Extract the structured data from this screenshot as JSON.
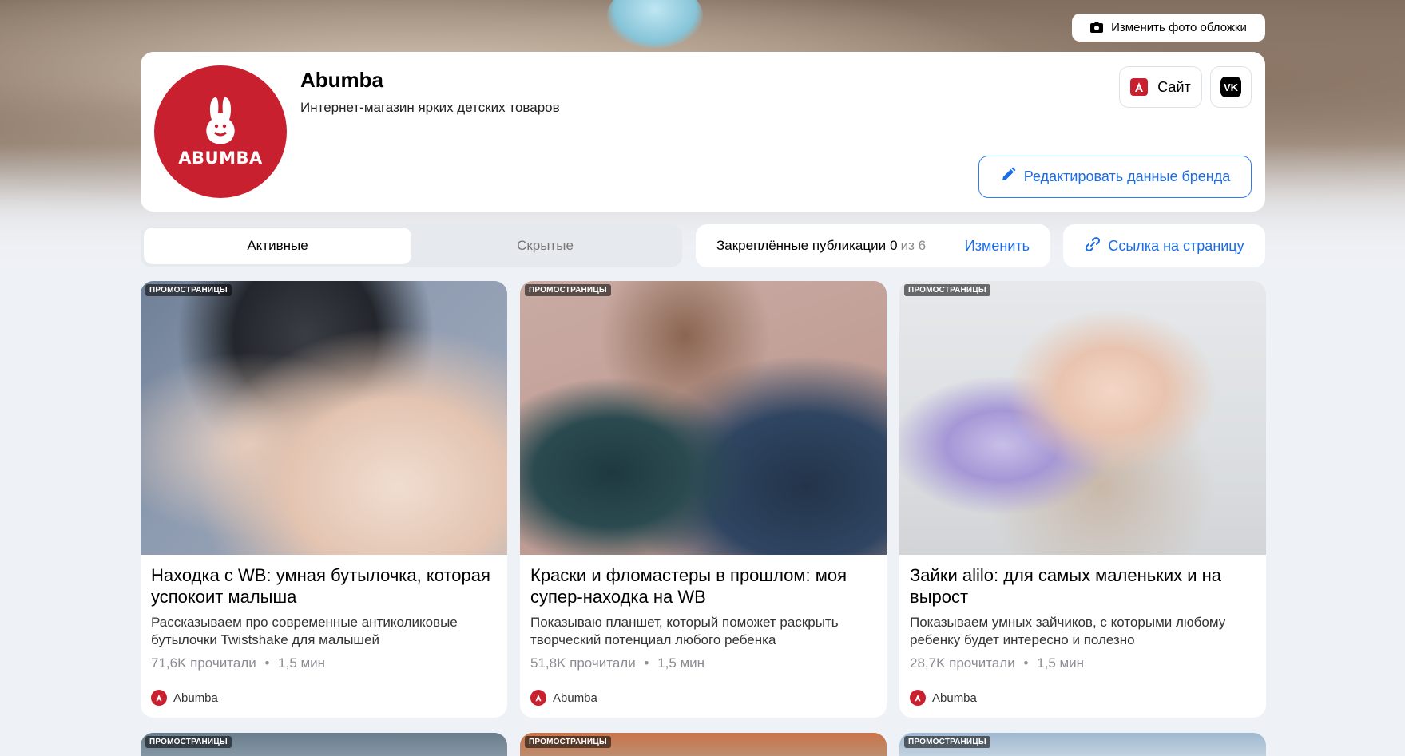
{
  "cover": {
    "change_cover_label": "Изменить фото обложки"
  },
  "brand": {
    "logo_text": "ABUMBA",
    "name": "Abumba",
    "description": "Интернет-магазин ярких детских товаров",
    "site_label": "Сайт",
    "vk_label": "VK",
    "edit_label": "Редактировать данные бренда",
    "accent_color": "#c8202f",
    "link_color": "#1a6ce8"
  },
  "tabs": [
    {
      "label": "Активные",
      "active": true
    },
    {
      "label": "Скрытые",
      "active": false
    }
  ],
  "pinned": {
    "label": "Закреплённые публикации",
    "count": "0",
    "total_text": "из 6",
    "change_label": "Изменить"
  },
  "page_link_label": "Ссылка на страницу",
  "articles": [
    {
      "badge": "ПРОМОСТРАНИЦЫ",
      "title": "Находка с WB: умная бутылочка, которая успокоит малыша",
      "description": "Рассказываем про современные антиколиковые бутылочки Twistshake для малышей",
      "reads": "71,6K прочитали",
      "duration": "1,5 мин",
      "author": "Abumba"
    },
    {
      "badge": "ПРОМОСТРАНИЦЫ",
      "title": "Краски и фломастеры в прошлом: моя супер-находка на WB",
      "description": "Показываю планшет, который поможет раскрыть творческий потенциал любого ребенка",
      "reads": "51,8K прочитали",
      "duration": "1,5 мин",
      "author": "Abumba"
    },
    {
      "badge": "ПРОМОСТРАНИЦЫ",
      "title": "Зайки alilo: для самых маленьких и на вырост",
      "description": "Показываем умных зайчиков, с которыми любому ребенку будет интересно и полезно",
      "reads": "28,7K прочитали",
      "duration": "1,5 мин",
      "author": "Abumba"
    }
  ],
  "more_articles": [
    {
      "badge": "ПРОМОСТРАНИЦЫ"
    },
    {
      "badge": "ПРОМОСТРАНИЦЫ"
    },
    {
      "badge": "ПРОМОСТРАНИЦЫ"
    }
  ],
  "meta_separator": "•"
}
